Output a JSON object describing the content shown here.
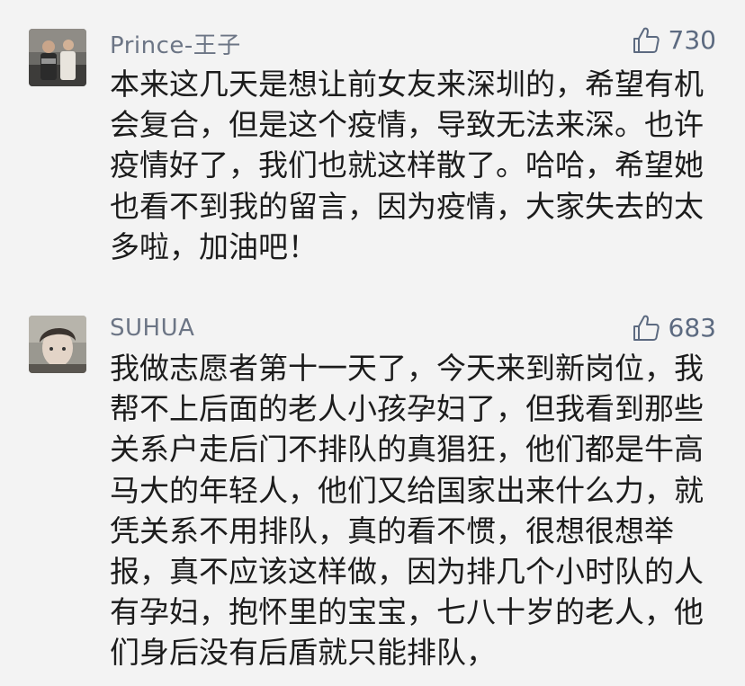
{
  "comments": [
    {
      "username": "Prince-王子",
      "likes": "730",
      "avatar": "photo-two-people",
      "lines": [
        "本来这几天是想让前女友来深圳的，希望有机",
        "会复合，但是这个疫情，导致无法来深。也许",
        "疫情好了，我们也就这样散了。哈哈，希望她",
        "也看不到我的留言，因为疫情，大家失去的太",
        "多啦，加油吧！"
      ]
    },
    {
      "username": "SUHUA",
      "likes": "683",
      "avatar": "photo-person-selfie",
      "lines": [
        "我做志愿者第十一天了，今天来到新岗位，我",
        "帮不上后面的老人小孩孕妇了，但我看到那些",
        "关系户走后门不排队的真猖狂，他们都是牛高",
        "马大的年轻人，他们又给国家出来什么力，就",
        "凭关系不用排队，真的看不惯，很想很想举",
        "报，真不应该这样做，因为排几个小时队的人",
        "有孕妇，抱怀里的宝宝，七八十岁的老人，他",
        "们身后没有后盾就只能排队，"
      ]
    }
  ],
  "colors": {
    "background": "#f3f3f3",
    "username": "#6c7585",
    "like": "#5c6a80",
    "text": "#1c1c1c"
  },
  "icons": {
    "like": "thumbs-up-icon"
  }
}
